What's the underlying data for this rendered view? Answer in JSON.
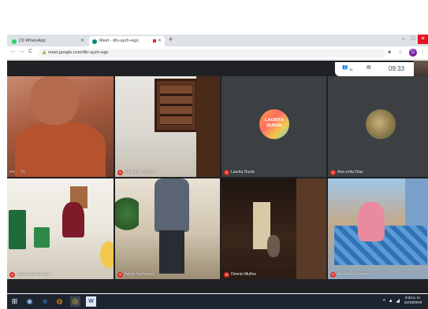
{
  "browser": {
    "tabs": [
      {
        "label": "(3) WhatsApp",
        "favicon_color": "#25d366"
      },
      {
        "label": "Meet - dfu-ayzh-wgv",
        "favicon_color": "#00897b"
      }
    ],
    "new_tab_symbol": "+",
    "window_controls": {
      "minimize": "–",
      "maximize": "□",
      "close": "✕"
    },
    "url": "meet.google.com/dfu-ayzh-wgv",
    "profile_initial": "D",
    "nav": {
      "back": "←",
      "forward": "→",
      "reload": "C"
    }
  },
  "meet": {
    "participant_count": "11",
    "clock": "09:33",
    "tiles": [
      {
        "name": "Tú",
        "muted": false
      },
      {
        "name": "Santiago Lozano",
        "muted": true
      },
      {
        "name": "Laurita Durán",
        "muted": true,
        "avatar_text": "LAURITA DURÁN"
      },
      {
        "name": "Ana sofia Díaz",
        "muted": true
      },
      {
        "name": "Juanita Bernal Ruiz",
        "muted": true
      },
      {
        "name": "Julian Sarmiento",
        "muted": true
      },
      {
        "name": "Dennis Muñoz",
        "muted": true
      },
      {
        "name": "Ana Milena Jones",
        "muted": true
      }
    ]
  },
  "taskbar": {
    "time": "9:33 a. m.",
    "date": "22/10/2020",
    "word_label": "W"
  }
}
